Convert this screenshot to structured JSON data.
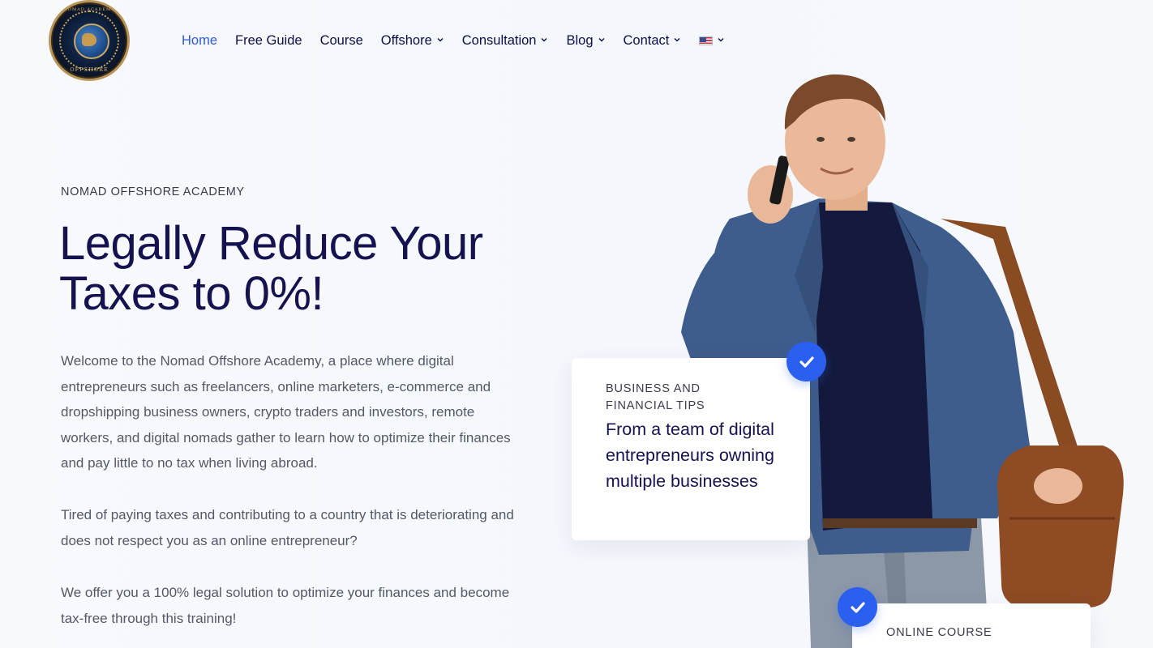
{
  "brand": {
    "logo_top_text": "NOMAD ACADEMY",
    "logo_bottom_text": "OFFSHORE"
  },
  "nav": {
    "items": [
      {
        "label": "Home",
        "active": true,
        "has_dropdown": false
      },
      {
        "label": "Free Guide",
        "active": false,
        "has_dropdown": false
      },
      {
        "label": "Course",
        "active": false,
        "has_dropdown": false
      },
      {
        "label": "Offshore",
        "active": false,
        "has_dropdown": true
      },
      {
        "label": "Consultation",
        "active": false,
        "has_dropdown": true
      },
      {
        "label": "Blog",
        "active": false,
        "has_dropdown": true
      },
      {
        "label": "Contact",
        "active": false,
        "has_dropdown": true
      }
    ],
    "language": {
      "icon": "us-flag-icon",
      "has_dropdown": true
    }
  },
  "hero": {
    "eyebrow": "NOMAD OFFSHORE ACADEMY",
    "headline_line1": "Legally Reduce Your",
    "headline_line2": "Taxes to 0%!",
    "paragraphs": [
      "Welcome to the Nomad Offshore Academy, a place where digital entrepreneurs such as freelancers, online marketers, e-commerce and dropshipping business owners, crypto traders and investors, remote workers, and digital nomads gather to learn how to optimize their finances and pay little to no tax when living abroad.",
      "Tired of paying taxes and contributing to a country that is deteriorating and does not respect you as an online entrepreneur?",
      "We offer you a 100% legal solution to optimize your finances and become tax-free through this training!"
    ]
  },
  "cards": {
    "tips": {
      "eyebrow": "BUSINESS AND FINANCIAL TIPS",
      "title": "From a team of digital entrepreneurs owning multiple businesses",
      "icon": "checkmark-icon"
    },
    "course": {
      "eyebrow": "ONLINE COURSE",
      "icon": "checkmark-icon"
    }
  },
  "colors": {
    "accent": "#2e5bd8",
    "check_badge": "#2b5ff0",
    "heading": "#15124f",
    "body_text": "#555866",
    "nav_text": "#0f0d4a"
  }
}
